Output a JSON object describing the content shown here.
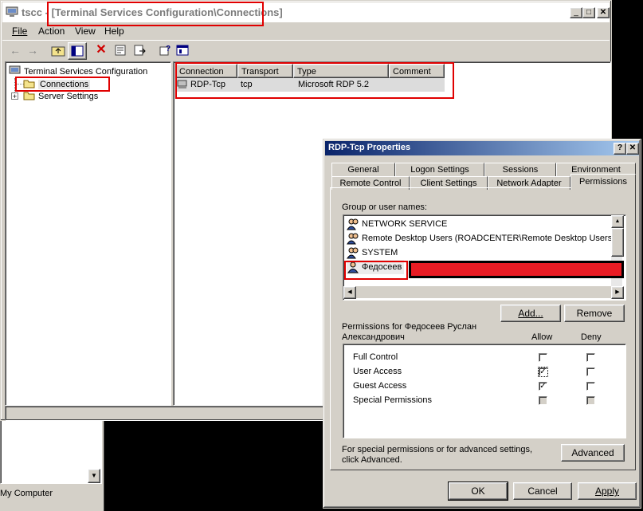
{
  "bg_window": {
    "status_text": "My Computer"
  },
  "main": {
    "title_app": "tscc - ",
    "title_path": "[Terminal Services Configuration\\Connections]",
    "menu": [
      "File",
      "Action",
      "View",
      "Help"
    ],
    "tree": {
      "root": "Terminal Services Configuration",
      "connections": "Connections",
      "server_settings": "Server Settings"
    },
    "list": {
      "columns": [
        "Connection",
        "Transport",
        "Type",
        "Comment"
      ],
      "rows": [
        {
          "connection": "RDP-Tcp",
          "transport": "tcp",
          "type": "Microsoft RDP 5.2",
          "comment": ""
        }
      ]
    }
  },
  "dialog": {
    "title": "RDP-Tcp Properties",
    "tabs_row1": [
      "General",
      "Logon Settings",
      "Sessions",
      "Environment"
    ],
    "tabs_row2": [
      "Remote Control",
      "Client Settings",
      "Network Adapter",
      "Permissions"
    ],
    "active_tab": "Permissions",
    "group_label": "Group or user names:",
    "users": [
      "NETWORK SERVICE",
      "Remote Desktop Users (ROADCENTER\\Remote Desktop Users)",
      "SYSTEM",
      "Федосеев"
    ],
    "add_button": "Add...",
    "remove_button": "Remove",
    "permissions_for_line1": "Permissions for Федосеев Руслан",
    "permissions_for_line2": "Александрович",
    "allow_header": "Allow",
    "deny_header": "Deny",
    "permissions": [
      {
        "name": "Full Control",
        "allow": "none",
        "deny": "none"
      },
      {
        "name": "User Access",
        "allow": "checked",
        "deny": "none"
      },
      {
        "name": "Guest Access",
        "allow": "checked",
        "deny": "none"
      },
      {
        "name": "Special Permissions",
        "allow": "gray",
        "deny": "gray"
      }
    ],
    "advanced_note_line1": "For special permissions or for advanced settings,",
    "advanced_note_line2": "click Advanced.",
    "advanced_button": "Advanced",
    "ok_button": "OK",
    "cancel_button": "Cancel",
    "apply_button": "Apply"
  }
}
